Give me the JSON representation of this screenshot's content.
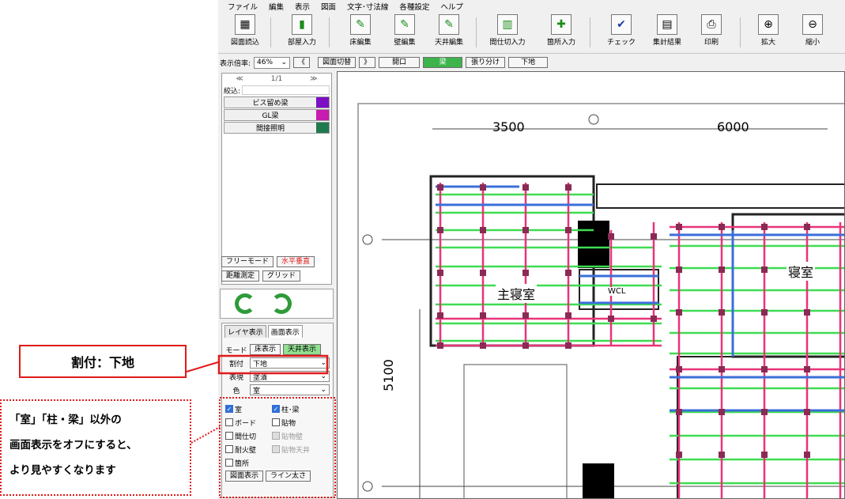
{
  "menu": [
    "ファイル",
    "編集",
    "表示",
    "図面",
    "文字･寸法線",
    "各種設定",
    "ヘルプ"
  ],
  "toolbar": [
    {
      "label": "図面読込",
      "icon": "drawing-open-icon"
    },
    {
      "label": "部屋入力",
      "icon": "room-input-icon"
    },
    {
      "label": "床編集",
      "icon": "floor-edit-icon"
    },
    {
      "label": "壁編集",
      "icon": "wall-edit-icon"
    },
    {
      "label": "天井編集",
      "icon": "ceiling-edit-icon"
    },
    {
      "label": "間仕切入力",
      "icon": "partition-input-icon"
    },
    {
      "label": "箇所入力",
      "icon": "location-input-icon"
    },
    {
      "label": "チェック",
      "icon": "check-icon"
    },
    {
      "label": "集計結果",
      "icon": "tally-results-icon"
    },
    {
      "label": "印刷",
      "icon": "print-icon"
    },
    {
      "label": "拡大",
      "icon": "zoom-in-icon"
    },
    {
      "label": "縮小",
      "icon": "zoom-out-icon"
    }
  ],
  "viewbar": {
    "zoom_label": "表示倍率:",
    "zoom_value": "46%",
    "prev": "《",
    "switch": "図面切替",
    "next": "》",
    "views": [
      "開口",
      "梁",
      "張り分け",
      "下地"
    ],
    "active_view": "梁"
  },
  "list": {
    "prev": "≪",
    "page": "1/1",
    "next": "≫",
    "filter_label": "絞込:",
    "items": [
      {
        "name": "ビス留め梁",
        "color": "#7d0fc4"
      },
      {
        "name": "GL梁",
        "color": "#c81bb0"
      },
      {
        "name": "間接照明",
        "color": "#1f7a4f"
      }
    ]
  },
  "tools": {
    "free": "フリーモード",
    "hv": "水平垂直",
    "measure": "距離測定",
    "grid": "グリッド"
  },
  "tabs": {
    "layer": "レイヤ表示",
    "screen": "画面表示"
  },
  "mode": {
    "label": "モード",
    "floor": "床表示",
    "ceiling": "天井表示"
  },
  "fields": {
    "waritsuke_label": "割付",
    "waritsuke_value": "下地",
    "hyogen_label": "表現",
    "hyogen_value": "塗潰",
    "iro_label": "色",
    "iro_value": "室"
  },
  "checks": {
    "shitsu": "室",
    "hashira": "柱･梁",
    "board": "ボード",
    "haributsu": "貼物",
    "majikiri": "間仕切",
    "taika": "耐火壁",
    "hari_kabe": "貼物壁",
    "hari_tenjo": "貼物天井",
    "kasho": "箇所"
  },
  "bottom": {
    "show": "図面表示",
    "line": "ライン太さ"
  },
  "drawing": {
    "dims": [
      "3500",
      "6000",
      "5100"
    ],
    "rooms": [
      "主寝室",
      "寝室",
      "WCL"
    ]
  },
  "callouts": {
    "title": "割付：下地",
    "note_1": "「室」「柱・梁」以外の",
    "note_2": "画面表示をオフにすると、",
    "note_3": "より見やすくなります"
  }
}
